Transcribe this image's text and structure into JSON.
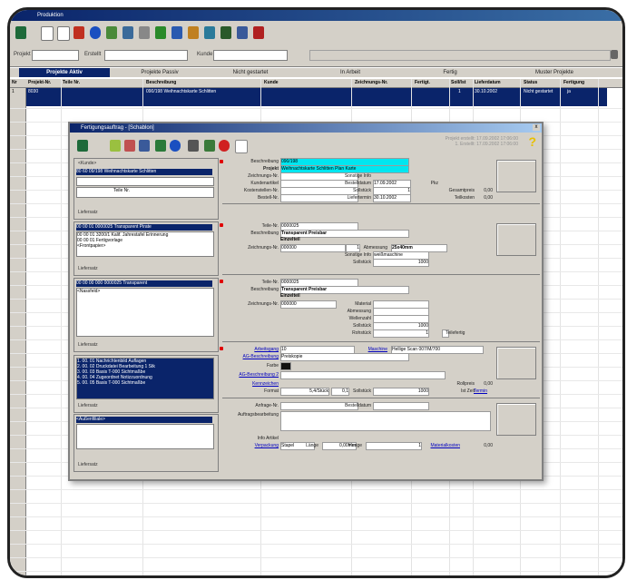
{
  "window": {
    "title": "Produktion"
  },
  "toolbar": {
    "icons": [
      "exit-icon",
      "new-icon",
      "blank-icon",
      "delete-icon",
      "info-icon",
      "people-icon",
      "people-alt-icon",
      "print-icon",
      "chart-icon",
      "document-icon",
      "tree-icon",
      "edit-icon",
      "list-icon",
      "lock-icon",
      "person-icon"
    ]
  },
  "filter": {
    "projekt_label": "Projekt",
    "projekt_value": "",
    "erstellt_label": "Erstellt",
    "erstellt_value": "",
    "kunde_label": "Kunde",
    "kunde_value": ""
  },
  "tabs": [
    "Projekte Aktiv",
    "Projekte Passiv",
    "Nicht gestartet",
    "In Arbeit",
    "Fertig",
    "Muster Projekte"
  ],
  "grid": {
    "headers": [
      "Nr",
      "Projekt-Nr.",
      "Teile Nr.",
      "Beschreibung",
      "Kunde",
      "Zeichnungs-Nr.",
      "Fertigt.",
      "Soll/Ist",
      "Lieferdatum",
      "Status",
      "Fertigung"
    ],
    "row1": {
      "nr": "1",
      "projekt_nr": "8030",
      "beschreibung": "090/198 Weihnachtskarte Schlitten",
      "soll": "1",
      "lieferdatum": "30.10.2002",
      "status": "Nicht gestartet",
      "fertigung": "ja"
    }
  },
  "dialog": {
    "title": "Fertigungsauftrag - [Schablon]",
    "hint_line1": "Projekt erstellt: 17.09.2002 17:06:00",
    "hint_line2": "1. Erstellt: 17.09.2002 17:06:00",
    "close": "x",
    "panel1": {
      "label_kunde": "<Kunde>",
      "selected": "80 60 09/198 Weihnachtskarte Schlitten",
      "teile_label": "Teile Nr.",
      "footer": "Liefersatz"
    },
    "panel2": {
      "selected": "00 00 01 0000025 Transparent Pirate",
      "lines": [
        "00 00 01 3200/1 Kalif. Jahrestafel Erinnerung",
        "00 00 01 Fertigvorlage",
        "<Frontpapier>"
      ],
      "footer": "Liefersatz"
    },
    "panel3": {
      "selected": "00 00 00 000 0000025 Transparent",
      "lines": [
        "<Nassfeld>"
      ],
      "footer": "Liefersatz"
    },
    "panel4": {
      "lines": [
        "1. 00. 01 Nachrichtenbild Auflagen",
        "2. 00. 02 Druckdatei Bearbeitung 1 Stk",
        "3. 00. 03 Basis T-000 Sichtmaßbe",
        "4. 00. 04 Zugeordnet Notizzuordnung",
        "5. 00. 05 Basis T-000 Sichtmaßbe"
      ],
      "footer": "Liefersatz"
    },
    "panel5": {
      "selected": "<Außenfiliale>",
      "footer": "Liefersatz"
    },
    "fields": {
      "beschreibung": {
        "label": "Beschreibung",
        "value": "090/198"
      },
      "projekt": {
        "label": "Projekt",
        "value": "Weihnachtskarte Schlitten Plan Karte"
      },
      "zeichnungs": {
        "label": "Zeichnungs-Nr.",
        "value": ""
      },
      "kundenartikel": {
        "label": "Kundenartikel",
        "value": ""
      },
      "bemerkung": {
        "label": "Bemerkung",
        "value": ""
      },
      "kostenstelle": {
        "label": "Kostenstellen-Nr.",
        "value": ""
      },
      "bestell": {
        "label": "Bestell-Nr.",
        "value": ""
      },
      "sonstige": {
        "label": "Sonstige Info",
        "value": ""
      },
      "bestelldatum": {
        "label": "Bestelldatum",
        "value": "17.09.2002"
      },
      "sollstueck": {
        "label": "Sollstück",
        "value": "1"
      },
      "liefertermin": {
        "label": "Liefertermin",
        "value": "30.10.2002"
      },
      "preis_label": "Pkz",
      "gesamtpreis": "Gesamtpreis",
      "gesamtpreis_val": "0,00",
      "teilkosten": "Teilkosten",
      "teilkosten_val": "0,00",
      "teile_nr2": {
        "label": "Teile-Nr.",
        "value": "0000025"
      },
      "beschreibung2": {
        "label": "Beschreibung",
        "value": "Transparent Preisbar"
      },
      "format2": {
        "label": "",
        "value": "Einzelteil"
      },
      "zeichnung2": {
        "label": "Zeichnungs-Nr.",
        "value": "000000"
      },
      "menge2": {
        "label": "Menge",
        "value": "1"
      },
      "abmessung": {
        "label": "Abmessung",
        "value": "25x40mm"
      },
      "wellenart": {
        "label": "Sonstige Info",
        "value": "weißmaschine"
      },
      "sollstueck2": {
        "label": "Sollstück",
        "value": "1000"
      },
      "teile_nr3": {
        "label": "Teile-Nr.",
        "value": "0000025"
      },
      "beschreibung3": {
        "label": "Beschreibung",
        "value": "Transparent Preisbar"
      },
      "format3": {
        "value": "Einzelteil"
      },
      "zeichnung3": {
        "label": "Zeichnungs-Nr.",
        "value": "000000"
      },
      "material": {
        "label": "Material",
        "value": ""
      },
      "abmessung3": {
        "label": "Abmessung",
        "value": ""
      },
      "wellenzahl": {
        "label": "Wellenzahl",
        "value": ""
      },
      "sollstueck3": {
        "label": "Sollstück",
        "value": "1000"
      },
      "rohstueck": {
        "label": "Rohstück",
        "value": "1"
      },
      "fertig_check": "Teilefertig",
      "arbeitsgang": {
        "label": "Arbeitsgang",
        "value": "10"
      },
      "maschine": {
        "label": "Maschine",
        "value": "Hellige Scan 007/M/700"
      },
      "ag_beschreibung": {
        "label": "AG-Beschreibung",
        "value": "Preiskopie"
      },
      "farbe": {
        "label": "Farbe",
        "value": ""
      },
      "ag_beschreibung2": {
        "label": "AG-Beschreibung 2",
        "value": ""
      },
      "kennzeichen": {
        "label": "Kennzeichen",
        "value": ""
      },
      "format": {
        "label": "Format",
        "value": "5,4/Stück"
      },
      "zeit": "0,1",
      "sollstueck4": {
        "label": "Sollstück",
        "value": "1000"
      },
      "rollpreis": "Rollpreis",
      "rollpreis_val": "0,00",
      "istzeit": "Ist Zeit",
      "termin": "Termin",
      "anfrage": {
        "label": "Anfrage-Nr.",
        "value": ""
      },
      "bestelldatum2": {
        "label": "Bestelldatum",
        "value": ""
      },
      "auftragsbearbeitung": {
        "label": "Auftragsbearbeitung",
        "value": ""
      },
      "info_artikel": {
        "label": "Info Artikel",
        "value": ""
      },
      "lieferart": {
        "label": "Verpackung",
        "value": "Stapel"
      },
      "lange": {
        "label": "Länge",
        "value": "0,00mm"
      },
      "menge_label": "Menge",
      "menge_val": "1",
      "materialkosten": {
        "label": "Materialkosten",
        "value": "0,00"
      }
    }
  },
  "colors": {
    "selection": "#0a246a",
    "highlight": "#00e6f0",
    "panel": "#d4d0c8",
    "required": "#e00000"
  }
}
